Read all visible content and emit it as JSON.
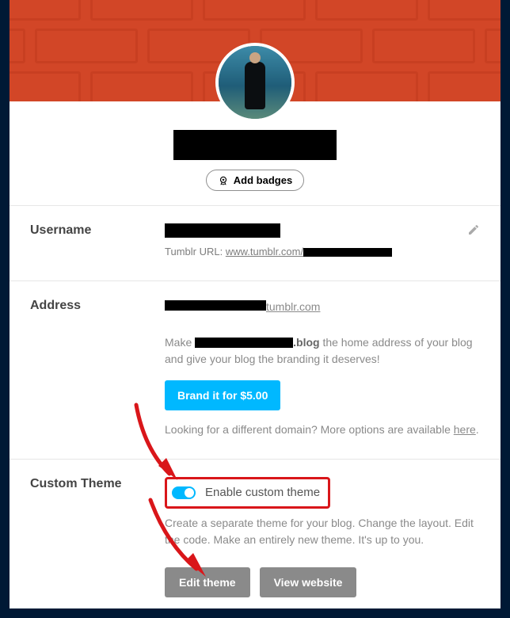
{
  "header": {
    "add_badges_label": "Add badges"
  },
  "username": {
    "label": "Username",
    "url_prefix": "Tumblr URL:",
    "url_base": "www.tumblr.com/"
  },
  "address": {
    "label": "Address",
    "domain_suffix": "tumblr.com",
    "make_prefix": "Make",
    "blog_suffix": ".blog",
    "pitch_tail": "the home address of your blog and give your blog the branding it deserves!",
    "brand_button": "Brand it for $5.00",
    "more_options": "Looking for a different domain? More options are available",
    "here": "here"
  },
  "custom_theme": {
    "label": "Custom Theme",
    "toggle_label": "Enable custom theme",
    "description": "Create a separate theme for your blog. Change the layout. Edit the code. Make an entirely new theme. It's up to you.",
    "edit_button": "Edit theme",
    "view_button": "View website"
  }
}
